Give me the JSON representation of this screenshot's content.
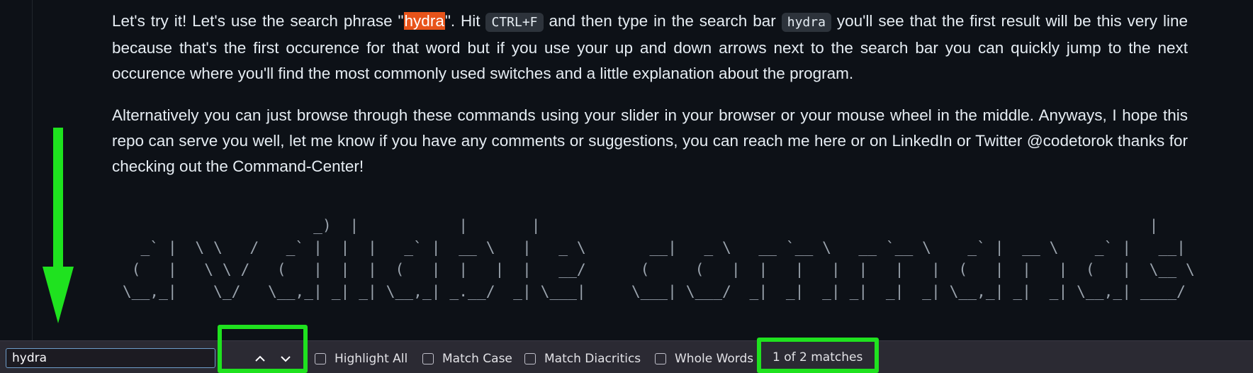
{
  "paragraph1": {
    "t1": "Let's try it! Let's use the search phrase \"",
    "highlight": "hydra",
    "t2": "\". Hit ",
    "kbd1": "CTRL+F",
    "t3": " and then type in the search bar ",
    "kbd2": "hydra",
    "t4": " you'll see that the first result will be this very line because that's the first occurence for that word but if you use your up and down arrows next to the search bar you can quickly jump to the next occurence where you'll find the most commonly used switches and a little explanation about the program."
  },
  "paragraph2": "Alternatively you can just browse through these commands using your slider in your browser or your mouse wheel in the middle. Anyways, I hope this repo can serve you well, let me know if you have any comments or suggestions, you can reach me here or on LinkedIn or Twitter @codetorok thanks for checking out the Command-Center!",
  "ascii_art": "                      _)  |           |       |                                                                   |\n   _` |  \\ \\   /   _` |  |  |   _` |  __ \\   |   _ \\       __|   _ \\   __ `__ \\   __ `__ \\    _` |  __ \\    _` |   __|\n  (   |   \\ \\ /   (   |  |  |  (   |  |   |  |   __/      (     (   |  |   |   |  |   |   |  (   |  |   |  (   |  \\__ \\\n \\__,_|    \\_/   \\__,_| _| _| \\__,_| _.__/  _| \\___|     \\___| \\___/  _|  _|  _| _|  _|  _| \\__,_| _|  _| \\__,_| ____/",
  "findbar": {
    "search_value": "hydra",
    "options": [
      "Highlight All",
      "Match Case",
      "Match Diacritics",
      "Whole Words"
    ],
    "status": "1 of 2 matches"
  },
  "colors": {
    "annotation": "#1fe21f",
    "highlight": "#e8541a",
    "background": "#0d1117",
    "findbar": "#2b2a33"
  },
  "icons": [
    "arrow-up-icon",
    "arrow-down-icon",
    "down-arrow-annotation"
  ]
}
